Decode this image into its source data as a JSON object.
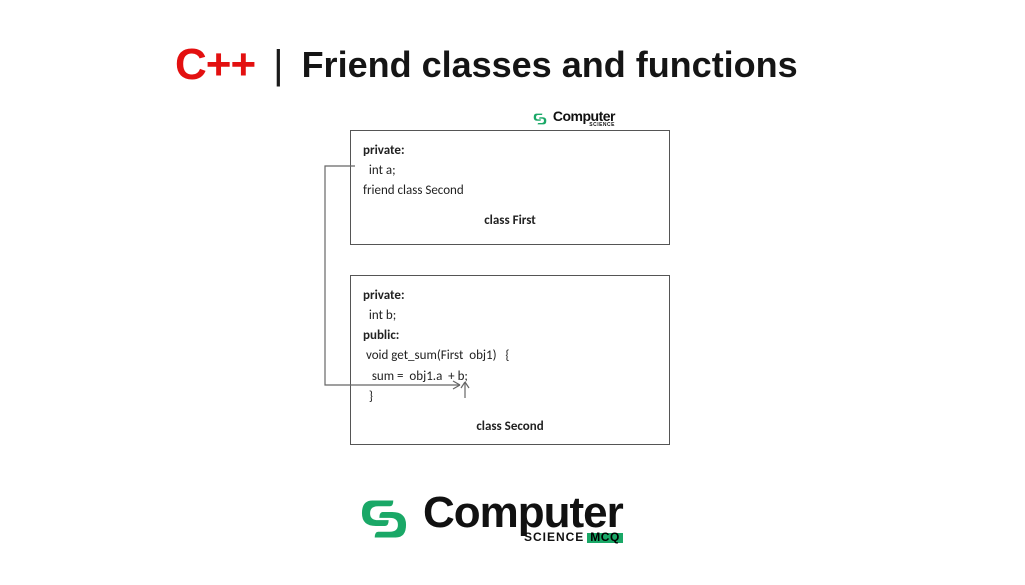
{
  "header": {
    "lang": "C++",
    "divider": "|",
    "title": "Friend classes and functions"
  },
  "diagram": {
    "class_first": {
      "lines": {
        "l1": "private:",
        "l2": "  int a;",
        "l3": "friend class Second"
      },
      "label": "class First"
    },
    "class_second": {
      "lines": {
        "l1": "private:",
        "l2": "  int b;",
        "l3": "public:",
        "l4": " void get_sum(First  obj1)   {",
        "l5": "",
        "l6": "   sum =  obj1.a  + b;",
        "l7": "  }"
      },
      "label": "class Second"
    }
  },
  "logo": {
    "word": "Computer",
    "sub": "SCIENCE",
    "mcq": "MCQ"
  }
}
